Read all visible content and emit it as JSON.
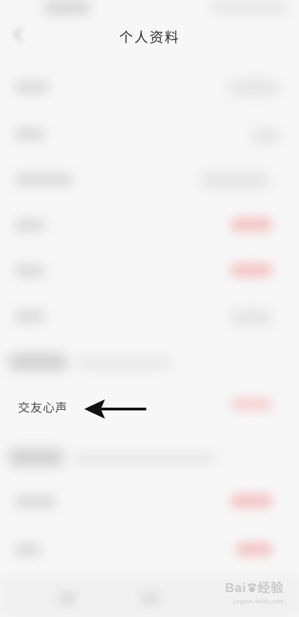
{
  "header": {
    "title": "个人资料"
  },
  "highlight": {
    "label": "交友心声"
  },
  "watermark": {
    "brand": "Bai",
    "brand_suffix": "经验",
    "url": "jingyan.baidu.com"
  },
  "colors": {
    "background": "#f7f7f7",
    "arrow": "#111111",
    "blur_red": "#f4c9c9"
  },
  "icons": {
    "back": "back-arrow-icon",
    "pointer": "arrow-left-icon",
    "watermark_paw": "paw-icon"
  }
}
